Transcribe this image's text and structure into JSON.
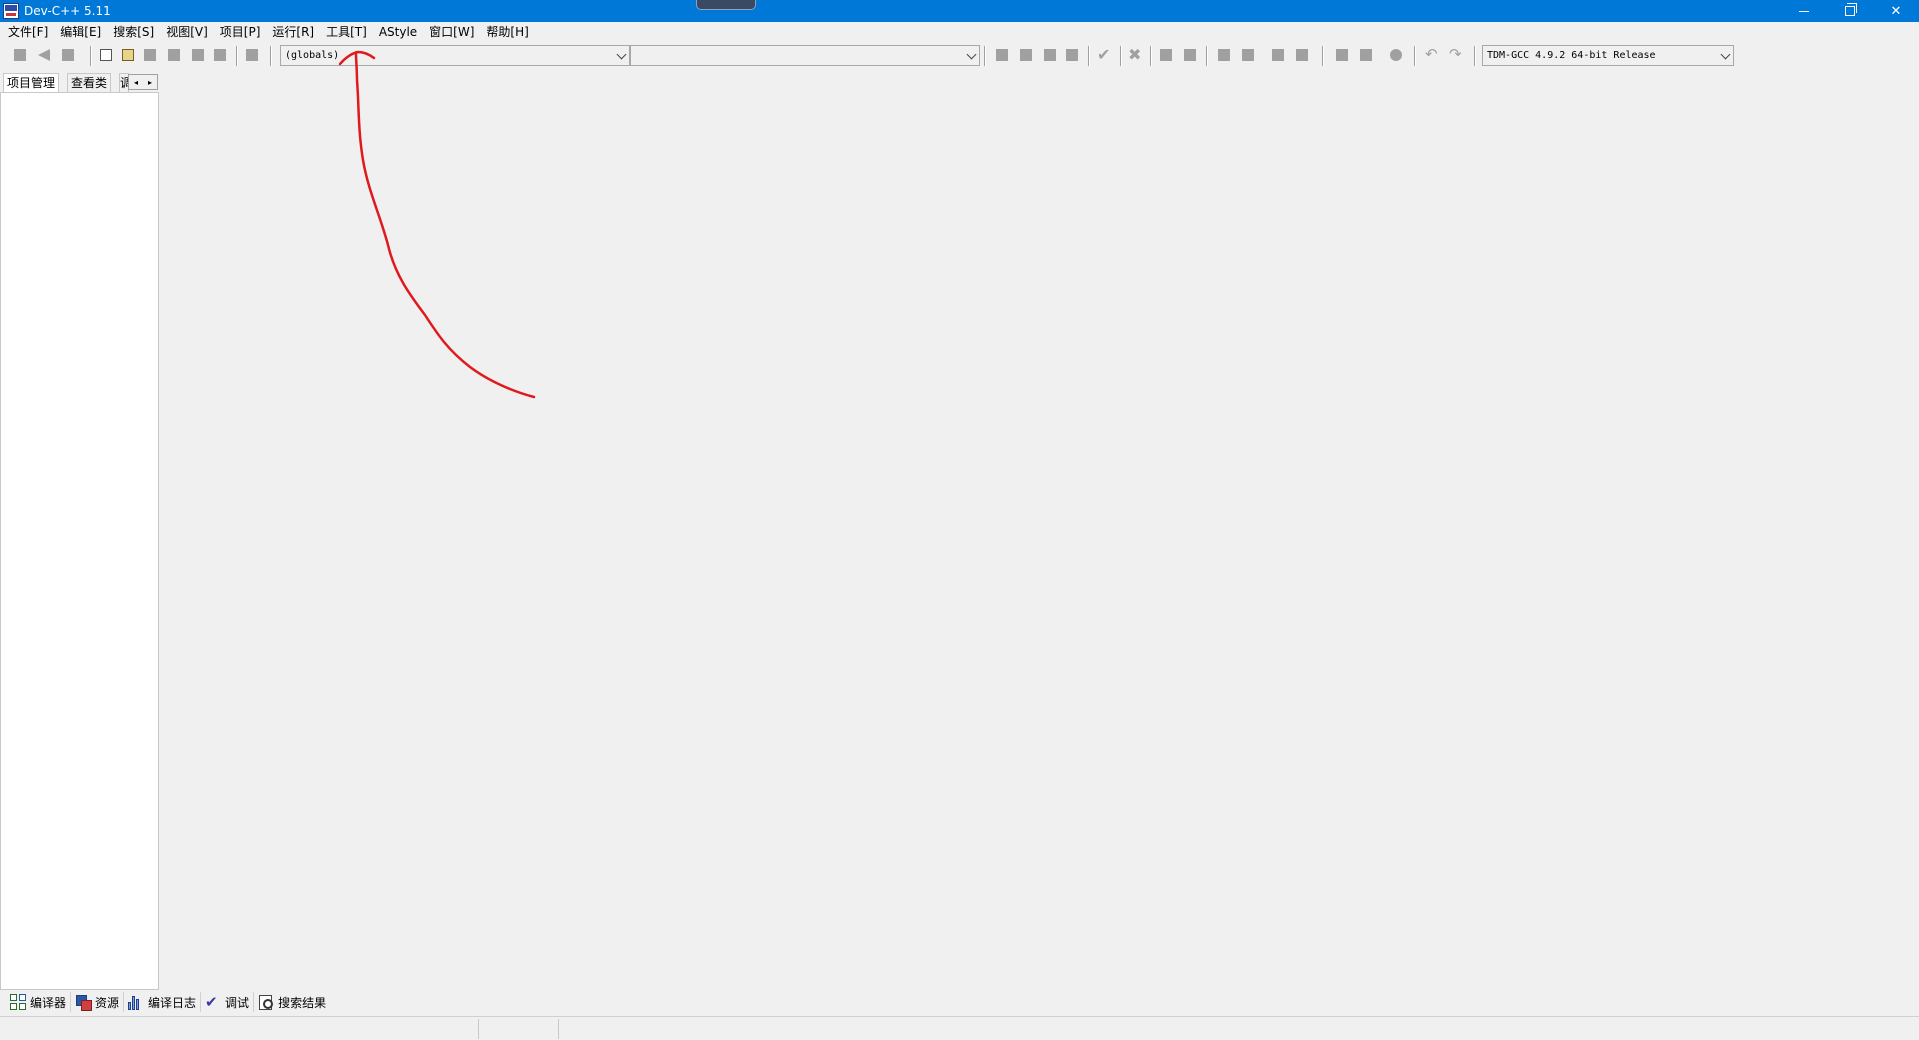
{
  "window": {
    "title": "Dev-C++ 5.11",
    "controls": [
      "minimize",
      "restore",
      "close"
    ]
  },
  "menubar": {
    "items": [
      {
        "label": "文件[F]"
      },
      {
        "label": "编辑[E]"
      },
      {
        "label": "搜索[S]"
      },
      {
        "label": "视图[V]"
      },
      {
        "label": "项目[P]"
      },
      {
        "label": "运行[R]"
      },
      {
        "label": "工具[T]"
      },
      {
        "label": "AStyle"
      },
      {
        "label": "窗口[W]"
      },
      {
        "label": "帮助[H]"
      }
    ]
  },
  "toolbar": {
    "scope_combo": {
      "value": "(globals)"
    },
    "member_combo": {
      "value": ""
    },
    "compiler_combo": {
      "value": "TDM-GCC 4.9.2 64-bit Release"
    }
  },
  "left_panel": {
    "tabs": [
      {
        "label": "项目管理"
      },
      {
        "label": "查看类"
      },
      {
        "label": "调"
      }
    ],
    "scroll_left": "◂",
    "scroll_right": "▸"
  },
  "bottom_tabs": {
    "items": [
      {
        "label": "编译器",
        "icon": "compiler-grid-icon"
      },
      {
        "label": "资源",
        "icon": "resources-icon"
      },
      {
        "label": "编译日志",
        "icon": "bar-chart-icon"
      },
      {
        "label": "调试",
        "icon": "checkmark-icon"
      },
      {
        "label": "搜索结果",
        "icon": "search-results-icon"
      }
    ]
  },
  "annotation": {
    "color": "#e0191c"
  },
  "colors": {
    "titlebar": "#0078d7",
    "background": "#f0f0f0",
    "toolbar_icon_disabled": "#a0a0a0"
  }
}
